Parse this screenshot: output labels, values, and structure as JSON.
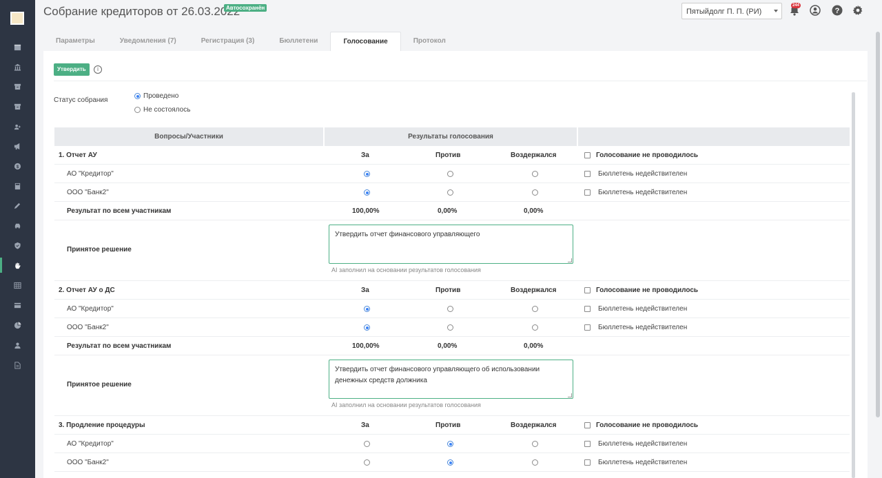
{
  "header": {
    "title": "Собрание кредиторов от 26.03.2022",
    "autosave_badge": "Автосохранён",
    "user": "Пятыйдолг П. П. (РИ)",
    "notification_count": "244"
  },
  "sidebar": {
    "items": [
      "calendar-icon",
      "bank-icon",
      "archive-icon",
      "archive-icon",
      "users-icon",
      "megaphone-icon",
      "coin-icon",
      "calculator-icon",
      "pen-icon",
      "car-icon",
      "shield-icon",
      "hand-icon",
      "table-icon",
      "card-icon",
      "pie-chart-icon",
      "user-icon",
      "document-icon"
    ],
    "active_item": "hand-icon"
  },
  "tabs": [
    {
      "label": "Параметры",
      "active": false
    },
    {
      "label": "Уведомления (7)",
      "active": false
    },
    {
      "label": "Регистрация (3)",
      "active": false
    },
    {
      "label": "Бюллетени",
      "active": false
    },
    {
      "label": "Голосование",
      "active": true
    },
    {
      "label": "Протокол",
      "active": false
    }
  ],
  "toolbar": {
    "approve_label": "Утвердить",
    "info_icon": "i"
  },
  "status": {
    "label": "Статус собрания",
    "options": [
      {
        "label": "Проведено",
        "checked": true
      },
      {
        "label": "Не состоялось",
        "checked": false
      }
    ]
  },
  "table": {
    "headers": {
      "questions": "Вопросы/Участники",
      "results": "Результаты голосования"
    },
    "vote_labels": {
      "for": "За",
      "against": "Против",
      "abstained": "Воздержался"
    },
    "not_held_label": "Голосование не проводилось",
    "invalid_label": "Бюллетень недействителен",
    "total_label": "Результат по всем участникам",
    "decision_label": "Принятое решение",
    "decision_hint": "AI заполнил на основании результатов голосования",
    "questions": [
      {
        "title": "1. Отчет АУ",
        "participants": [
          {
            "name": "АО \"Кредитор\"",
            "vote": "for"
          },
          {
            "name": "ООО \"Банк2\"",
            "vote": "for"
          }
        ],
        "totals": {
          "for": "100,00%",
          "against": "0,00%",
          "abstained": "0,00%"
        },
        "decision": "Утвердить отчет финансового управляющего"
      },
      {
        "title": "2. Отчет АУ о ДС",
        "participants": [
          {
            "name": "АО \"Кредитор\"",
            "vote": "for"
          },
          {
            "name": "ООО \"Банк2\"",
            "vote": "for"
          }
        ],
        "totals": {
          "for": "100,00%",
          "against": "0,00%",
          "abstained": "0,00%"
        },
        "decision": "Утвердить отчет финансового управляющего об использовании денежных средств должника"
      },
      {
        "title": "3. Продление процедуры",
        "participants": [
          {
            "name": "АО \"Кредитор\"",
            "vote": "against"
          },
          {
            "name": "ООО \"Банк2\"",
            "vote": "against"
          }
        ]
      }
    ]
  }
}
